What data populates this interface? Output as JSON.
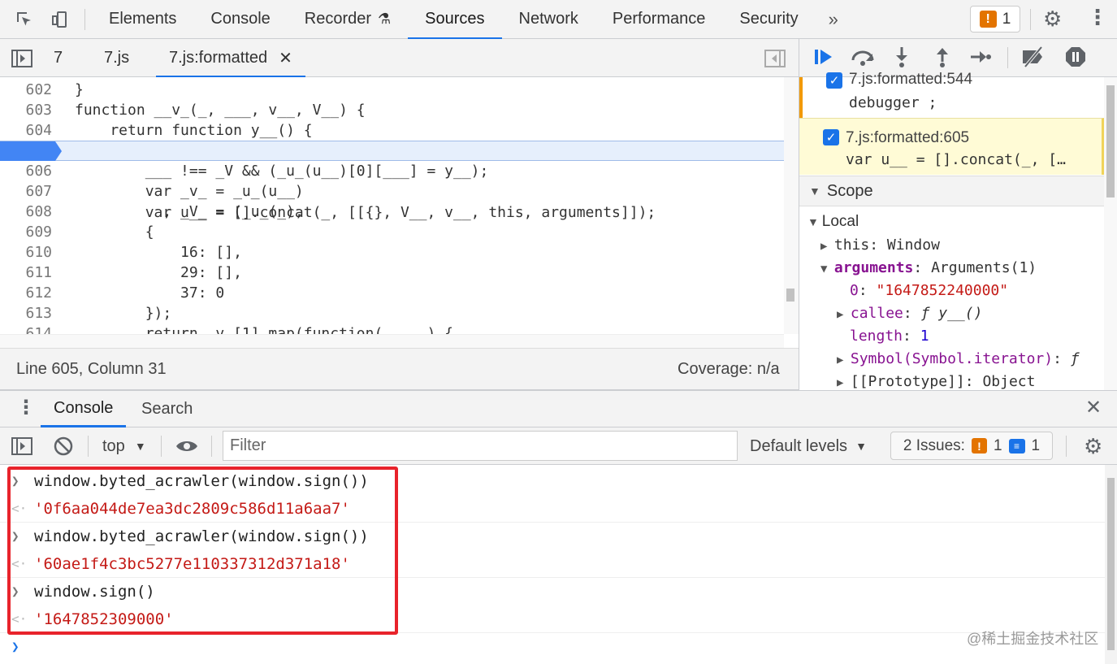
{
  "top_tabs": [
    "Elements",
    "Console",
    "Recorder",
    "Sources",
    "Network",
    "Performance",
    "Security"
  ],
  "active_top_tab": "Sources",
  "issues_count": "1",
  "file_tabs": [
    "7",
    "7.js",
    "7.js:formatted"
  ],
  "code_lines": [
    {
      "n": "602",
      "t": "}"
    },
    {
      "n": "603",
      "t": "function __v_(_, ___, v__, V__) {"
    },
    {
      "n": "604",
      "t": "    return function y__() {"
    },
    {
      "n": "605",
      "t": "        var u__ = [].concat(_, [[{}, V__, v__, this, arguments]]);"
    },
    {
      "n": "606",
      "t": "        ___ !== _V && (_u_(u__)[0][___] = y__);"
    },
    {
      "n": "607",
      "t": "        var _v_ = _u_(u__)"
    },
    {
      "n": "608",
      "t": "          , _V_ = (_u_(_),"
    },
    {
      "n": "609",
      "t": "        {"
    },
    {
      "n": "610",
      "t": "            16: [],"
    },
    {
      "n": "611",
      "t": "            29: [],"
    },
    {
      "n": "612",
      "t": "            37: 0"
    },
    {
      "n": "613",
      "t": "        });"
    },
    {
      "n": "614",
      "t": "        return _v_[1].map(function(_____) {"
    }
  ],
  "status": {
    "position": "Line 605, Column 31",
    "coverage": "Coverage: n/a"
  },
  "breakpoints": [
    {
      "location": "7.js:formatted:544",
      "code": "debugger ;"
    },
    {
      "location": "7.js:formatted:605",
      "code": "var u__ = [].concat(_, […"
    }
  ],
  "scope": {
    "header": "Scope",
    "local_label": "Local",
    "this_name": "this",
    "this_value": "Window",
    "args_name": "arguments",
    "args_value": "Arguments(1)",
    "arg0_key": "0",
    "arg0_value": "\"1647852240000\"",
    "callee_name": "callee",
    "callee_value": "ƒ y__()",
    "length_name": "length",
    "length_value": "1",
    "symbol_name": "Symbol(Symbol.iterator)",
    "symbol_value": "ƒ",
    "proto_name": "[[Prototype]]",
    "proto_value": "Object"
  },
  "drawer_tabs": [
    "Console",
    "Search"
  ],
  "console_toolbar": {
    "context": "top",
    "filter_placeholder": "Filter",
    "levels": "Default levels",
    "issues_label": "2 Issues:",
    "warn_count": "1",
    "info_count": "1"
  },
  "console_entries": [
    {
      "input": "window.byted_acrawler(window.sign())",
      "output": "'0f6aa044de7ea3dc2809c586d11a6aa7'"
    },
    {
      "input": "window.byted_acrawler(window.sign())",
      "output": "'60ae1f4c3bc5277e110337312d371a18'"
    },
    {
      "input": "window.sign()",
      "output": "'1647852309000'"
    }
  ],
  "watermark": "@稀土掘金技术社区",
  "colors": {
    "accent": "#1a73e8",
    "highlight_box": "#e8232b",
    "string": "#c41a16"
  }
}
